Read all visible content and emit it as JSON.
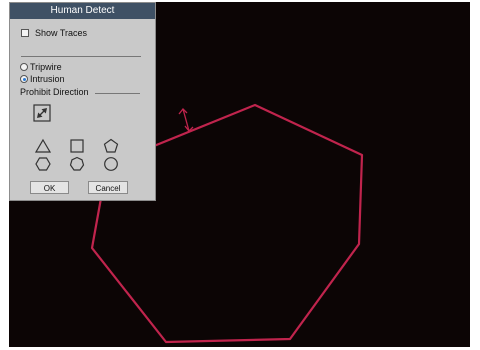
{
  "dialog": {
    "title": "Human Detect",
    "show_traces_label": "Show Traces",
    "show_traces_checked": false,
    "mode_options": [
      "Tripwire",
      "Intrusion"
    ],
    "selected_mode": "Intrusion",
    "prohibit_direction_label": "Prohibit Direction",
    "ok_label": "OK",
    "cancel_label": "Cancel",
    "shape_icons": [
      "triangle-icon",
      "square-icon",
      "pentagon-icon",
      "hexagon-icon",
      "heptagon-icon",
      "circle-icon"
    ],
    "direction_icon": "direction-arrow-icon"
  },
  "colors": {
    "video_bg": "#0c0505",
    "zone_stroke": "#c0244d",
    "titlebar_bg": "#3f5165",
    "panel_bg": "#c9c9c9",
    "radio_dot": "#2b7bd6"
  }
}
